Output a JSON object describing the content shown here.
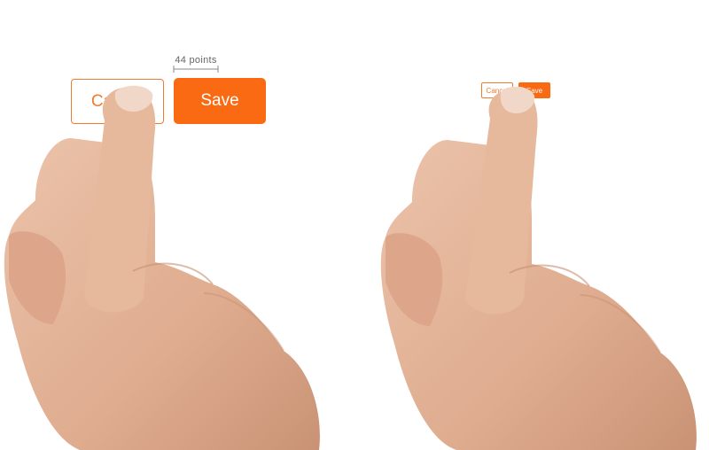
{
  "left_panel": {
    "measure_label": "44 points",
    "cancel_label": "Cancel",
    "save_label": "Save"
  },
  "right_panel": {
    "cancel_label": "Cancel",
    "save_label": "Save"
  },
  "colors": {
    "accent": "#fa6a12",
    "outline": "#f07a2e",
    "skin": "#e2b196",
    "skin_shadow": "#c98f72"
  },
  "icons": [
    "pointing-hand-icon"
  ]
}
